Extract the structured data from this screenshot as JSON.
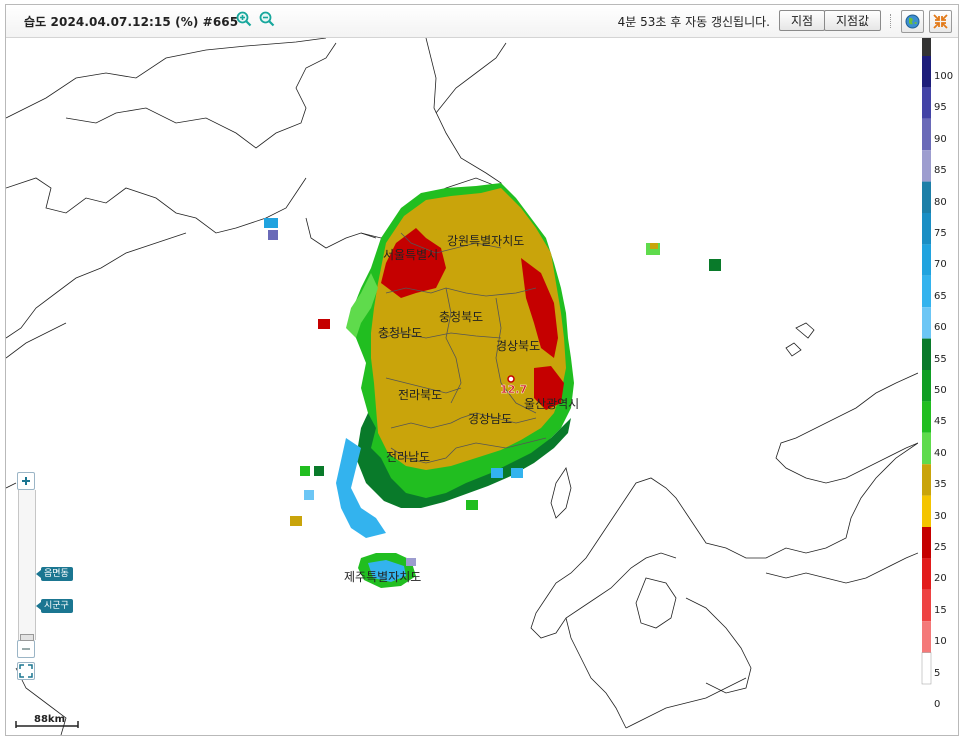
{
  "toolbar": {
    "title": "습도 2024.04.07.12:15 (%) #665",
    "refresh_text": "4분 53초 후 자동 갱신됩니다.",
    "btn_point": "지점",
    "btn_point_value": "지점값"
  },
  "map": {
    "regions": [
      "서울특별시",
      "강원특별자치도",
      "충청북도",
      "충청남도",
      "경상북도",
      "전라북도",
      "경상남도",
      "울산광역시",
      "전라남도",
      "제주특별자치도"
    ],
    "point_value": "12.7",
    "scale_label": "88km"
  },
  "zoom_control": {
    "tag_town": "읍면동",
    "tag_city": "시군구"
  },
  "legend": {
    "labels": [
      "100",
      "95",
      "90",
      "85",
      "80",
      "75",
      "70",
      "65",
      "60",
      "55",
      "50",
      "45",
      "40",
      "35",
      "30",
      "25",
      "20",
      "15",
      "10",
      "5",
      "0"
    ],
    "colors": [
      "#333333",
      "#1d1d7a",
      "#4343a6",
      "#6a6ab8",
      "#9d9dcf",
      "#1d7fa8",
      "#1a8ec4",
      "#20a3df",
      "#33b3ee",
      "#6cc6f5",
      "#097a2a",
      "#0e9e23",
      "#21be20",
      "#5fdb4c",
      "#c9a40b",
      "#f4c400",
      "#c50000",
      "#e21b1b",
      "#ee4343",
      "#f47979",
      "#ffffff"
    ]
  }
}
